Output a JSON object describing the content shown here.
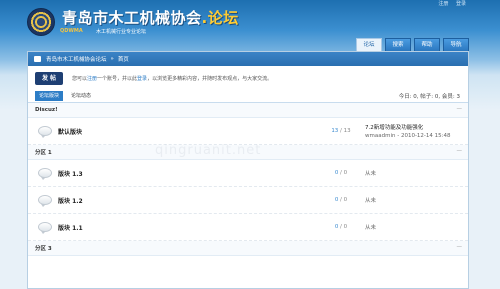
{
  "top_links": [
    "注册",
    "登录"
  ],
  "site": {
    "title": "青岛市木工机械协会",
    "title_accent": ".论坛",
    "brand": "QDWMA",
    "subtitle": "木工机械行业专业论坛"
  },
  "nav": [
    "论坛",
    "搜索",
    "帮助",
    "导航"
  ],
  "breadcrumb": {
    "site": "青岛市木工机械协会论坛",
    "sep": "»",
    "current": "首页"
  },
  "notice": {
    "post_button": "发 帖",
    "prefix": "您可以",
    "register": "注册",
    "middle": "一个账号，并以此",
    "login": "登录",
    "suffix": "，以浏览更多精彩内容，并随时发布观点，与大家交流。"
  },
  "tabs": [
    "论坛版块",
    "论坛动态"
  ],
  "stats": "今日: 0, 帖子: 0, 会员: 3",
  "watermark": "qingruanit.net",
  "categories": [
    {
      "name": "Discuz!",
      "collapse": "—",
      "forums": [
        {
          "name": "默认版块",
          "threads": "13",
          "posts": "13",
          "last_title": "7.2新增功能及功能强化",
          "last_user": "wmaadmin",
          "last_time": "2010-12-14 15:48",
          "never": ""
        }
      ]
    },
    {
      "name": "分区 1",
      "collapse": "—",
      "forums": [
        {
          "name": "版块 1.3",
          "threads": "0",
          "posts": "0",
          "last_title": "",
          "last_user": "",
          "last_time": "",
          "never": "从未"
        },
        {
          "name": "版块 1.2",
          "threads": "0",
          "posts": "0",
          "last_title": "",
          "last_user": "",
          "last_time": "",
          "never": "从未"
        },
        {
          "name": "版块 1.1",
          "threads": "0",
          "posts": "0",
          "last_title": "",
          "last_user": "",
          "last_time": "",
          "never": "从未"
        }
      ]
    },
    {
      "name": "分区 3",
      "collapse": "—",
      "forums": []
    }
  ]
}
